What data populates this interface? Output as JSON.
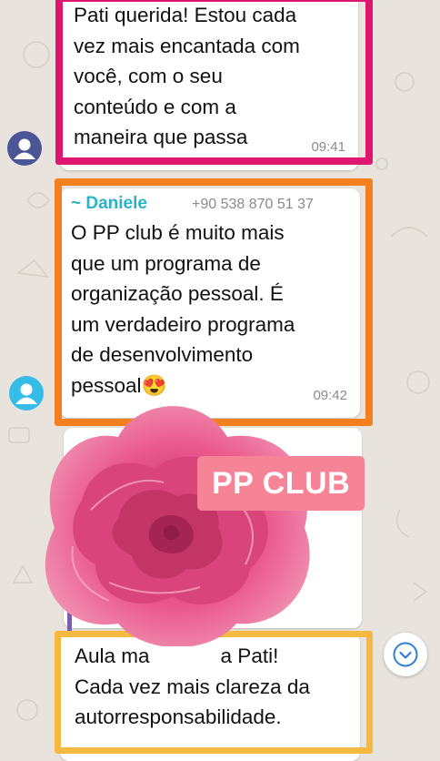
{
  "colors": {
    "wallpaper": "#e8e3dc",
    "frame_magenta": "#e0156f",
    "frame_orange": "#f47f1e",
    "frame_yellow": "#f5b840",
    "sender_name": "#2ab3c6",
    "avatar_navy": "#4a5696",
    "avatar_cyan": "#35bde8",
    "stamp_background": "#f68496",
    "rose_pink": "#e9578c"
  },
  "messages": [
    {
      "lines": [
        "Pati querida! Estou cada",
        "vez mais encantada com",
        "você, com o seu",
        "conteúdo e com a",
        "maneira que passa"
      ],
      "time": "09:41",
      "avatar_icon": "person-icon"
    },
    {
      "sender_name": "~ Daniele",
      "sender_phone": "+90 538 870 51 37",
      "lines": [
        "O PP club é muito mais",
        "que um programa de",
        "organização pessoal. É",
        "um verdadeiro programa",
        "de desenvolvimento",
        "pessoal"
      ],
      "emoji": "😍",
      "time": "09:42",
      "avatar_icon": "person-icon"
    },
    {
      "lines": [
        "Aula ma",
        "a Pati!",
        "Cada vez mais clareza da",
        "autorresponsabilidade."
      ]
    }
  ],
  "sticker": {
    "label": "PP CLUB",
    "icon": "rose-sticker"
  },
  "scroll_button": {
    "icon": "chevron-down-icon"
  }
}
